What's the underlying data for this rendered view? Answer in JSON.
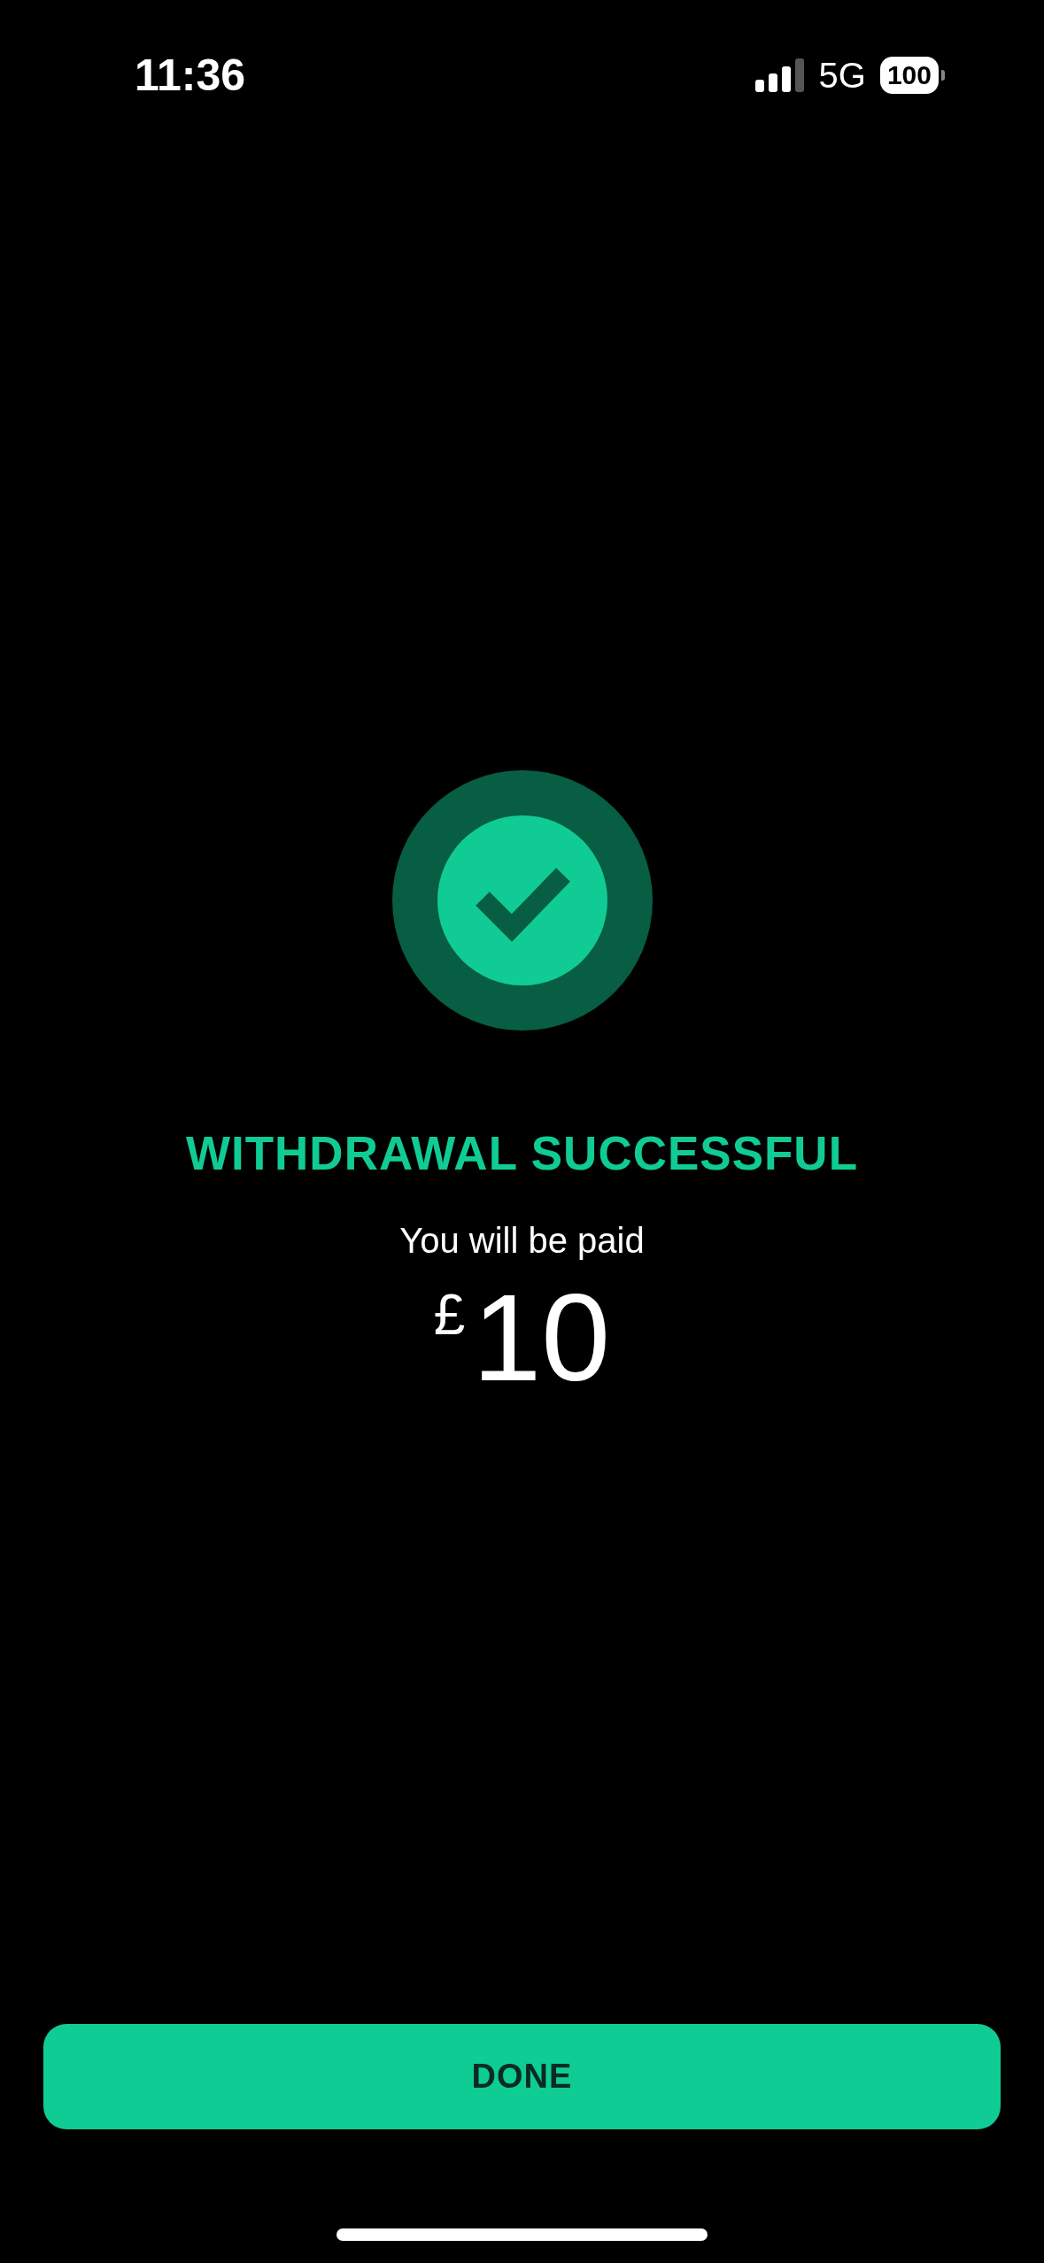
{
  "status_bar": {
    "time": "11:36",
    "network": "5G",
    "battery": "100"
  },
  "result": {
    "title": "WITHDRAWAL SUCCESSFUL",
    "subtitle": "You will be paid",
    "currency": "£",
    "amount": "10"
  },
  "button": {
    "label": "DONE"
  }
}
